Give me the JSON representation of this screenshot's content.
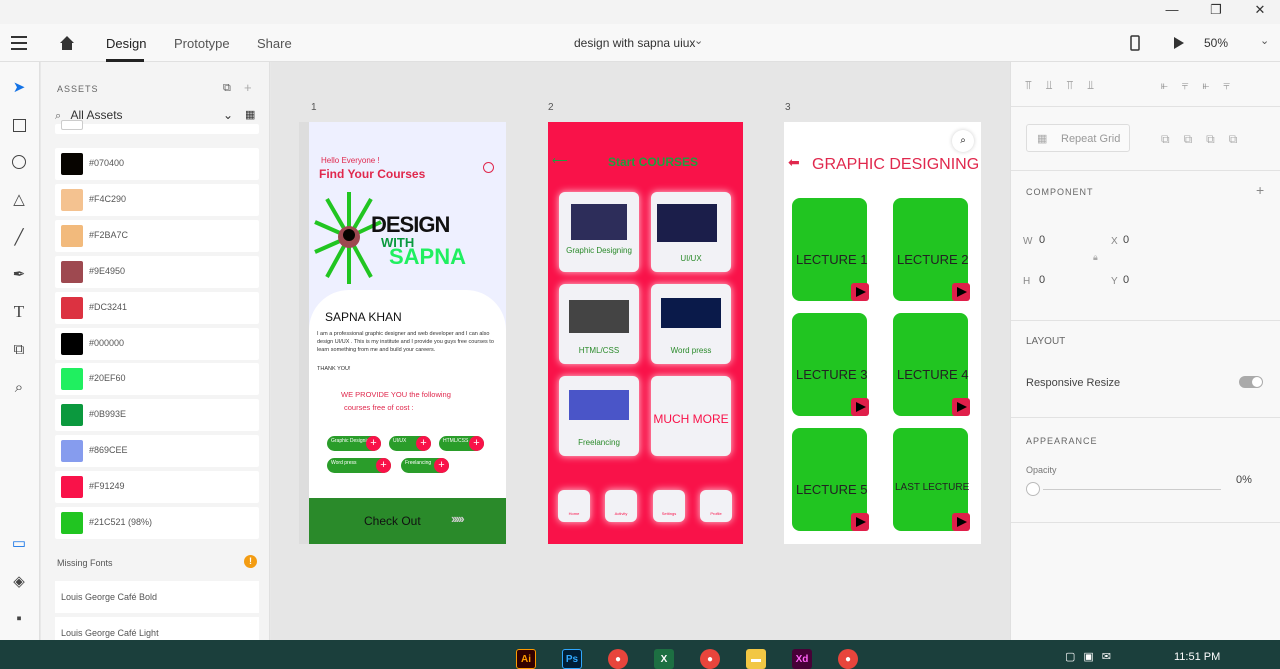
{
  "window": {
    "title": "design with sapna uiux"
  },
  "menu": {
    "design": "Design",
    "prototype": "Prototype",
    "share": "Share",
    "zoom": "50%"
  },
  "assets": {
    "header": "ASSETS",
    "filter": "All Assets",
    "colors": [
      {
        "hex": "#070400",
        "label": "#070400"
      },
      {
        "hex": "#F4C290",
        "label": "#F4C290"
      },
      {
        "hex": "#F2BA7C",
        "label": "#F2BA7C"
      },
      {
        "hex": "#9E4950",
        "label": "#9E4950"
      },
      {
        "hex": "#DC3241",
        "label": "#DC3241"
      },
      {
        "hex": "#000000",
        "label": "#000000"
      },
      {
        "hex": "#20EF60",
        "label": "#20EF60"
      },
      {
        "hex": "#0B993E",
        "label": "#0B993E"
      },
      {
        "hex": "#869CEE",
        "label": "#869CEE"
      },
      {
        "hex": "#F91249",
        "label": "#F91249"
      },
      {
        "hex": "#21C521",
        "label": "#21C521 (98%)"
      }
    ],
    "missing_fonts_header": "Missing Fonts",
    "fonts": [
      "Louis George Café Bold",
      "Louis George Café Light"
    ]
  },
  "artboards": {
    "labels": [
      "1",
      "2",
      "3"
    ],
    "a1": {
      "greeting": "Hello Everyone !",
      "title": "Find Your Courses",
      "logo_line1": "DESIGN",
      "logo_line2": "WITH",
      "logo_line3": "SAPNA",
      "name": "SAPNA KHAN",
      "bio": "I am a professional graphic designer and web developer and I can also design UI/UX . This is my institute and I provide you guys free courses to learn something from me and build your careers.",
      "thanks": "THANK YOU!",
      "provide_line1": "WE PROVIDE YOU the following",
      "provide_line2": "courses free of cost :",
      "pills": [
        "Graphic Designing",
        "UI/UX",
        "HTML/CSS",
        "Word press",
        "Freelancing"
      ],
      "checkout": "Check Out"
    },
    "a2": {
      "title": "Start COURSES",
      "cards": [
        "Graphic Designing",
        "UI/UX",
        "HTML/CSS",
        "Word press",
        "Freelancing",
        "MUCH MORE"
      ],
      "nav": [
        "Home",
        "Activity",
        "Settings",
        "Profile"
      ]
    },
    "a3": {
      "title": "GRAPHIC DESIGNING",
      "lectures": [
        "LECTURE 1",
        "LECTURE 2",
        "LECTURE 3",
        "LECTURE 4",
        "LECTURE 5",
        "LAST LECTURE"
      ]
    }
  },
  "properties": {
    "repeat_grid": "Repeat Grid",
    "component": "COMPONENT",
    "w_label": "W",
    "w_value": "0",
    "h_label": "H",
    "h_value": "0",
    "x_label": "X",
    "x_value": "0",
    "y_label": "Y",
    "y_value": "0",
    "layout": "LAYOUT",
    "responsive_resize": "Responsive Resize",
    "appearance": "APPEARANCE",
    "opacity_label": "Opacity",
    "opacity_value": "0%"
  },
  "taskbar": {
    "time": "11:51 PM"
  }
}
